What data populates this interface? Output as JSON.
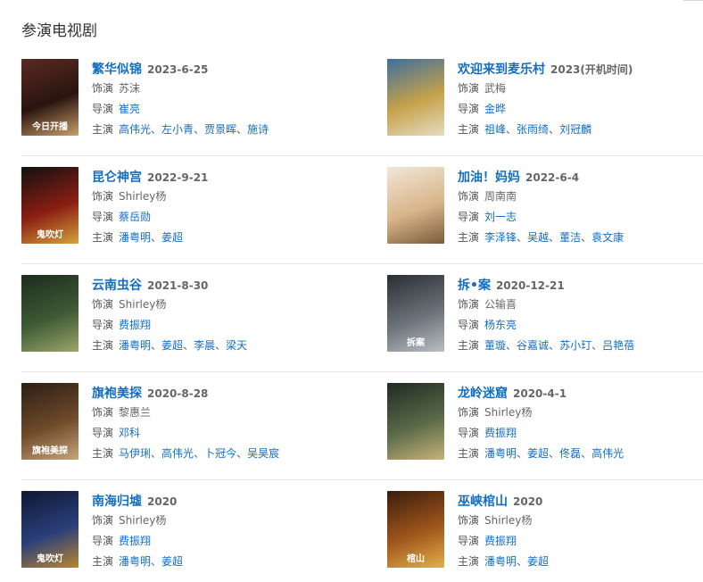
{
  "section_title": "参演电视剧",
  "labels": {
    "role": "饰演",
    "director": "导演",
    "cast": "主演"
  },
  "colors": {
    "link": "#136ec2",
    "text": "#333333",
    "divider": "#e8e8e8"
  },
  "dramas": [
    {
      "title": "繁华似锦",
      "year": "2023-6-25",
      "role": "苏沫",
      "directors": [
        "崔亮"
      ],
      "cast": [
        "高伟光",
        "左小青",
        "贾景晖",
        "施诗"
      ],
      "poster_text": "今日开播",
      "poster_colors": [
        "#5a2a22",
        "#2a1410",
        "#c9a06a"
      ]
    },
    {
      "title": "欢迎来到麦乐村",
      "year": "2023(开机时间)",
      "role": "武梅",
      "directors": [
        "金晔"
      ],
      "cast": [
        "祖峰",
        "张雨绮",
        "刘冠麟"
      ],
      "poster_text": "",
      "poster_colors": [
        "#3f6e9e",
        "#c6a24a",
        "#e6dcc4"
      ]
    },
    {
      "title": "昆仑神宫",
      "year": "2022-9-21",
      "role": "Shirley杨",
      "directors": [
        "蔡岳勋"
      ],
      "cast": [
        "潘粤明",
        "姜超"
      ],
      "poster_text": "鬼吹灯",
      "poster_colors": [
        "#111111",
        "#8b1d12",
        "#d4a23a"
      ]
    },
    {
      "title": "加油！妈妈",
      "year": "2022-6-4",
      "role": "周南南",
      "directors": [
        "刘一志"
      ],
      "cast": [
        "李泽锋",
        "吴越",
        "董洁",
        "袁文康"
      ],
      "poster_text": "",
      "poster_colors": [
        "#f1e7d8",
        "#d9b58a",
        "#7a5a3a"
      ]
    },
    {
      "title": "云南虫谷",
      "year": "2021-8-30",
      "role": "Shirley杨",
      "directors": [
        "费振翔"
      ],
      "cast": [
        "潘粤明",
        "姜超",
        "李晨",
        "梁天"
      ],
      "poster_text": "",
      "poster_colors": [
        "#1d2b1e",
        "#3e5a34",
        "#9aa66a"
      ]
    },
    {
      "title": "拆•案",
      "year": "2020-12-21",
      "role": "公输喜",
      "directors": [
        "杨东亮"
      ],
      "cast": [
        "董璇",
        "谷嘉诚",
        "苏小玎",
        "吕艳蓓"
      ],
      "poster_text": "拆案",
      "poster_colors": [
        "#2a2e33",
        "#6b7178",
        "#b9bec4"
      ]
    },
    {
      "title": "旗袍美探",
      "year": "2020-8-28",
      "role": "黎惠兰",
      "directors": [
        "邓科"
      ],
      "cast": [
        "马伊琍",
        "高伟光",
        "卜冠今",
        "吴昊宸"
      ],
      "poster_text": "旗袍美探",
      "poster_colors": [
        "#2b1d14",
        "#6e4a2a",
        "#c7a57a"
      ]
    },
    {
      "title": "龙岭迷窟",
      "year": "2020-4-1",
      "role": "Shirley杨",
      "directors": [
        "费振翔"
      ],
      "cast": [
        "潘粤明",
        "姜超",
        "佟磊",
        "高伟光"
      ],
      "poster_text": "",
      "poster_colors": [
        "#1f2a22",
        "#5a6a48",
        "#c9b27a"
      ]
    },
    {
      "title": "南海归墟",
      "year": "2020",
      "role": "Shirley杨",
      "directors": [
        "费振翔"
      ],
      "cast": [
        "潘粤明",
        "姜超"
      ],
      "poster_text": "鬼吹灯",
      "poster_colors": [
        "#0f1733",
        "#2a3f7a",
        "#b8862e"
      ]
    },
    {
      "title": "巫峡棺山",
      "year": "2020",
      "role": "Shirley杨",
      "directors": [
        "费振翔"
      ],
      "cast": [
        "潘粤明",
        "姜超"
      ],
      "poster_text": "棺山",
      "poster_colors": [
        "#3a1c0c",
        "#a0561c",
        "#e3b04a"
      ]
    }
  ]
}
